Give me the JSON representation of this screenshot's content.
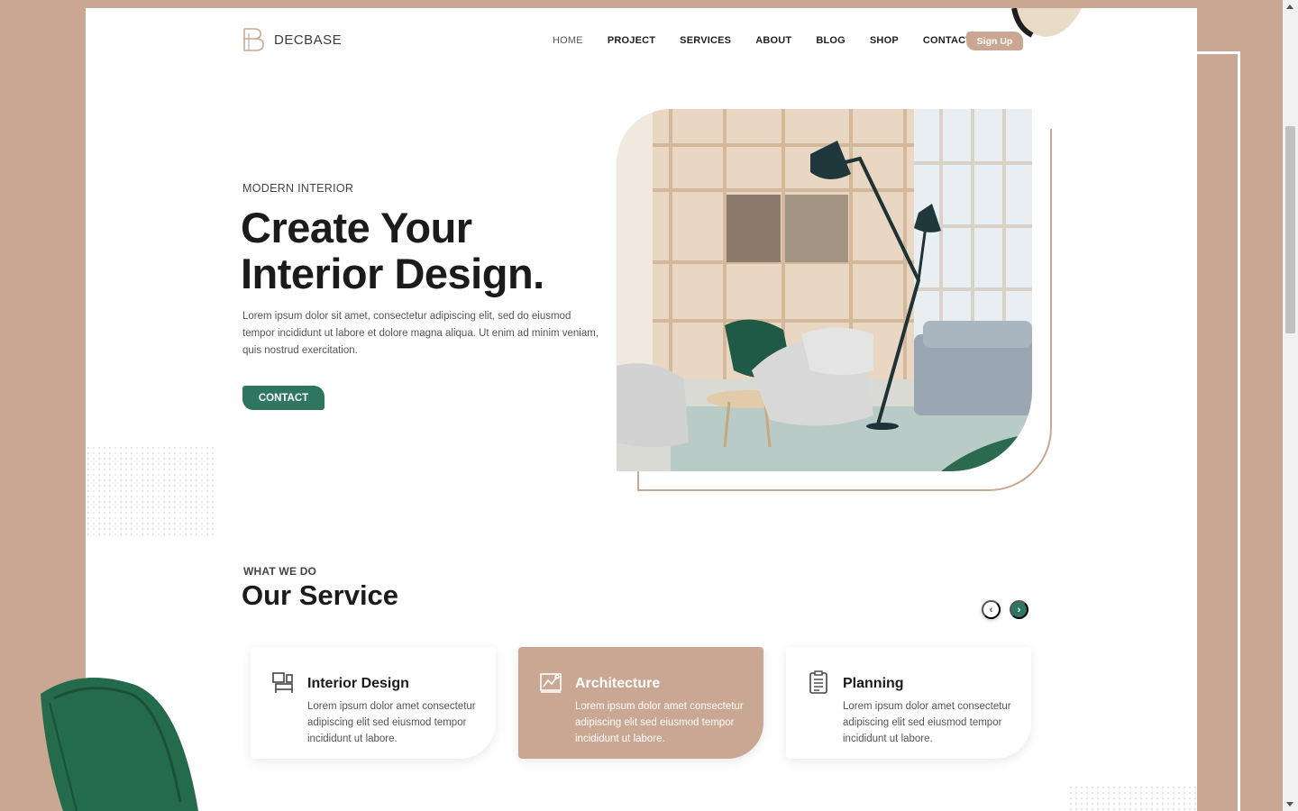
{
  "brand": {
    "name": "DECBASE"
  },
  "nav": {
    "items": [
      {
        "label": "HOME",
        "active": true
      },
      {
        "label": "PROJECT"
      },
      {
        "label": "SERVICES"
      },
      {
        "label": "ABOUT"
      },
      {
        "label": "BLOG"
      },
      {
        "label": "SHOP"
      },
      {
        "label": "CONTACT"
      }
    ],
    "signup_label": "Sign Up"
  },
  "hero": {
    "eyebrow": "MODERN INTERIOR",
    "title_line1": "Create Your",
    "title_line2": "Interior Design.",
    "description": "Lorem ipsum dolor sit amet, consectetur adipiscing elit, sed do eiusmod tempor incididunt ut labore et dolore magna aliqua. Ut enim ad minim veniam, quis nostrud exercitation.",
    "cta_label": "CONTACT"
  },
  "services": {
    "eyebrow": "WHAT WE DO",
    "title": "Our Service",
    "prev_arrow": "‹",
    "next_arrow": "›",
    "cards": [
      {
        "title": "Interior Design",
        "description": "Lorem ipsum dolor amet consectetur adipiscing elit sed eiusmod tempor incididunt ut labore.",
        "icon": "interior-design-icon"
      },
      {
        "title": "Architecture",
        "description": "Lorem ipsum dolor amet consectetur adipiscing elit sed eiusmod tempor incididunt ut labore.",
        "icon": "architecture-icon",
        "highlighted": true
      },
      {
        "title": "Planning",
        "description": "Lorem ipsum dolor amet consectetur adipiscing elit sed eiusmod tempor incididunt ut labore.",
        "icon": "planning-icon"
      }
    ]
  },
  "colors": {
    "accent_tan": "#c9a792",
    "accent_green": "#2f7660",
    "text_dark": "#1b1b1b"
  }
}
